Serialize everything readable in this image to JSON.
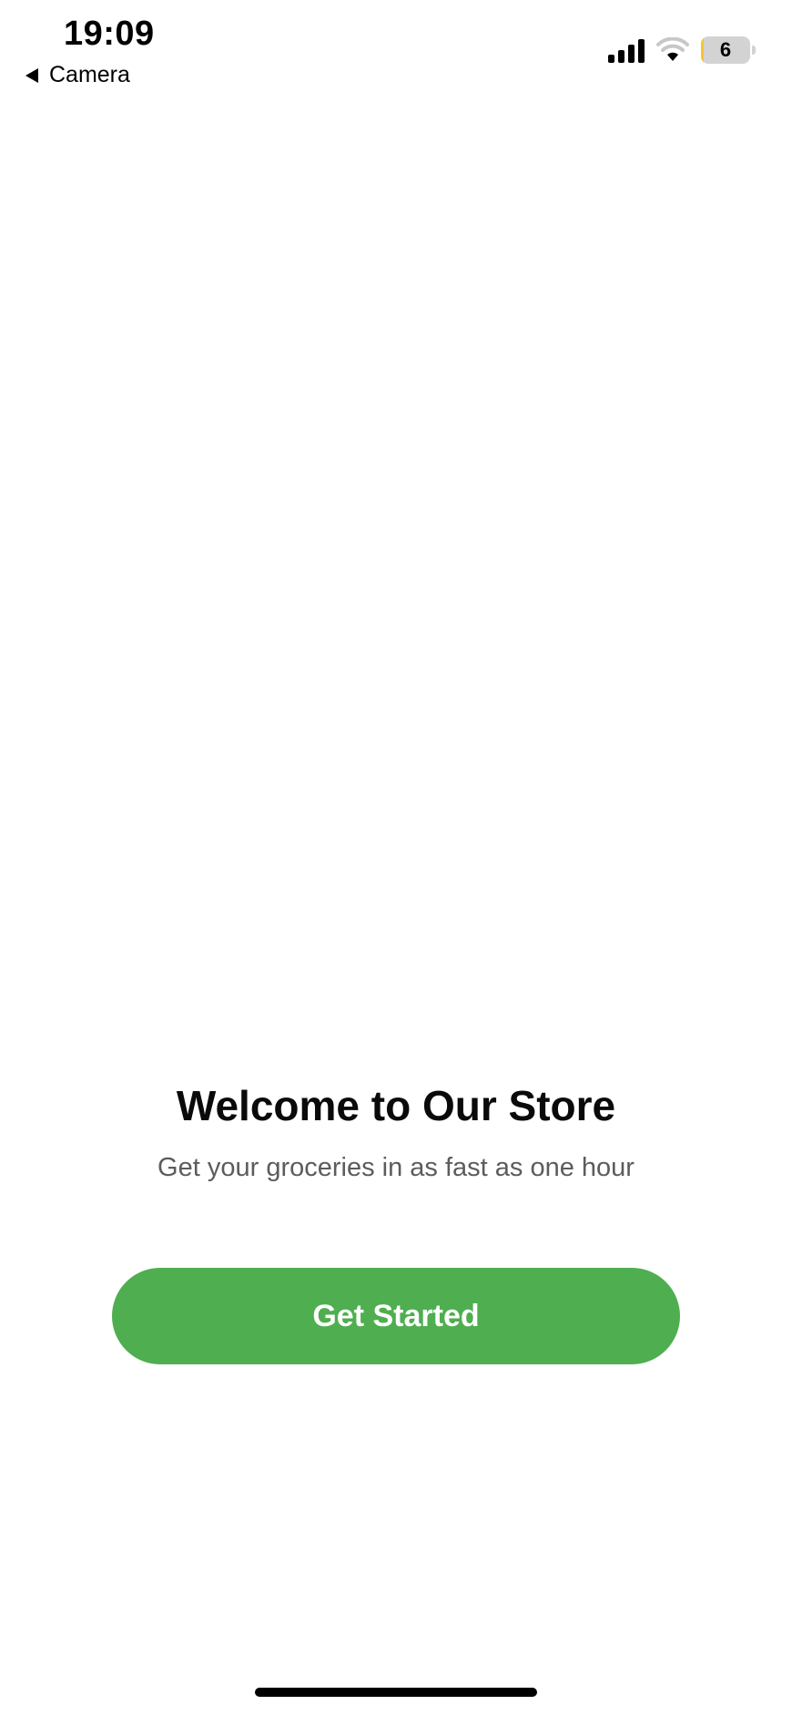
{
  "status_bar": {
    "time": "19:09",
    "back_label": "Camera",
    "battery_level": "6",
    "battery_fraction": 0.06,
    "battery_color": "#f4c533"
  },
  "welcome": {
    "title": "Welcome to Our Store",
    "subtitle": "Get your groceries in as fast as one hour"
  },
  "actions": {
    "get_started_label": "Get Started",
    "accent_color": "#4fae4f"
  },
  "icons": [
    "back-arrow-icon",
    "signal-icon",
    "wifi-icon",
    "battery-icon"
  ]
}
